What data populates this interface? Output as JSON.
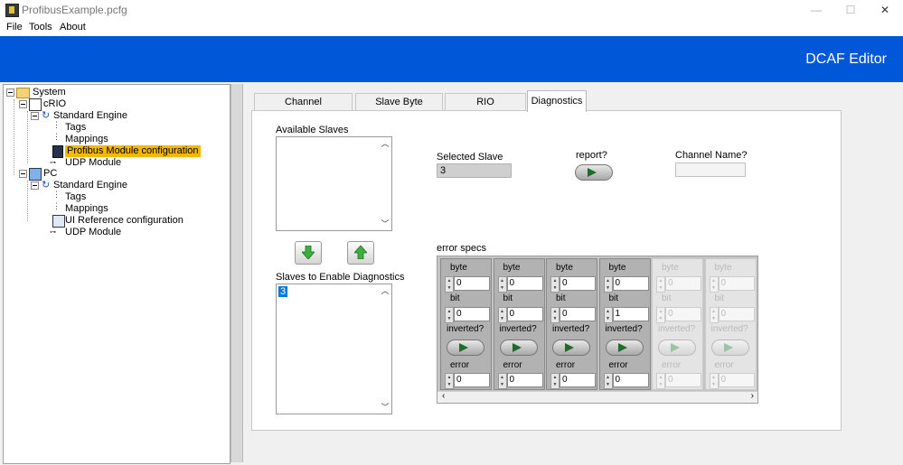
{
  "window": {
    "title": "ProfibusExample.pcfg",
    "minimize": "—",
    "maximize": "☐",
    "close": "✕"
  },
  "menu": {
    "file": "File",
    "tools": "Tools",
    "about": "About"
  },
  "header": {
    "title": "DCAF Editor"
  },
  "tree": {
    "system": "System",
    "crio": "cRIO",
    "crio_engine": "Standard Engine",
    "crio_tags": "Tags",
    "crio_mappings": "Mappings",
    "crio_profibus": "Profibus Module configuration",
    "crio_udp": "UDP Module",
    "pc": "PC",
    "pc_engine": "Standard Engine",
    "pc_tags": "Tags",
    "pc_mappings": "Mappings",
    "pc_ui_ref": "UI Reference configuration",
    "pc_udp": "UDP Module"
  },
  "tabs": [
    "Channel Configuration",
    "Slave Byte Ordering",
    "RIO Configuration",
    "Diagnostics"
  ],
  "diagnostics": {
    "available_slaves_label": "Available Slaves",
    "slaves_enable_label": "Slaves to Enable Diagnostics",
    "slaves_enable_items": [
      "3"
    ],
    "selected_slave_label": "Selected Slave",
    "selected_slave_value": "3",
    "report_label": "report?",
    "channel_name_label": "Channel Name?",
    "channel_name_value": "",
    "error_specs_label": "error specs",
    "field_labels": {
      "byte": "byte",
      "bit": "bit",
      "inverted": "inverted?",
      "error": "error"
    },
    "clusters": [
      {
        "byte": "0",
        "bit": "0",
        "error": "0",
        "enabled": true
      },
      {
        "byte": "0",
        "bit": "0",
        "error": "0",
        "enabled": true
      },
      {
        "byte": "0",
        "bit": "0",
        "error": "0",
        "enabled": true
      },
      {
        "byte": "0",
        "bit": "1",
        "error": "0",
        "enabled": true
      },
      {
        "byte": "0",
        "bit": "0",
        "error": "0",
        "enabled": false
      },
      {
        "byte": "0",
        "bit": "0",
        "error": "0",
        "enabled": false
      }
    ]
  },
  "colors": {
    "header_bg": "#0057d8",
    "selection": "#f5b800",
    "list_selection": "#0078d7",
    "arrow_green": "#3fae3f"
  }
}
